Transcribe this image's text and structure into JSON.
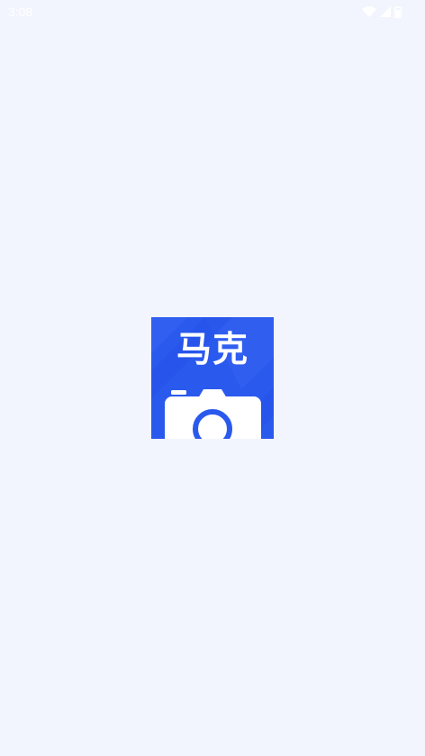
{
  "status_bar": {
    "time": "3:08",
    "icons": [
      "wifi-icon",
      "cellular-signal-icon",
      "battery-icon"
    ]
  },
  "splash": {
    "logo_text": "马克",
    "logo_icon": "camera-icon",
    "colors": {
      "background": "#f2f5fd",
      "brand_blue": "#2a59ee",
      "camera_body": "#ffffff"
    }
  }
}
